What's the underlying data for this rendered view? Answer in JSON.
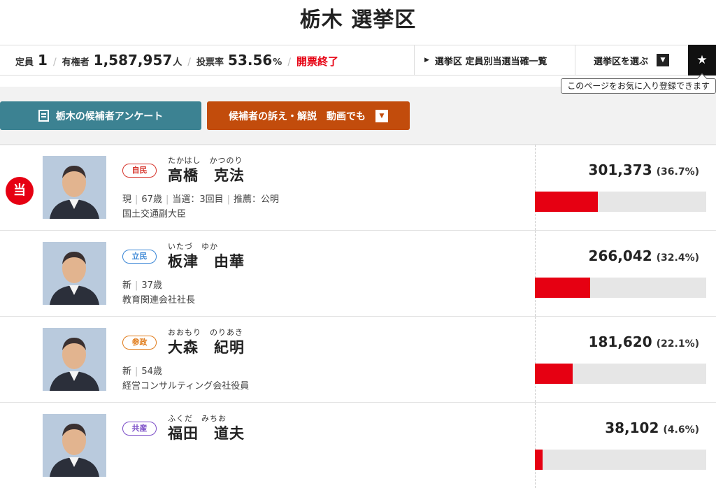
{
  "page": {
    "title": "栃木 選挙区"
  },
  "info": {
    "seats_label": "定員",
    "seats": "1",
    "voters_label": "有権者",
    "voters": "1,587,957",
    "voters_unit": "人",
    "turnout_label": "投票率",
    "turnout": "53.56",
    "turnout_unit": "%",
    "status": "開票終了"
  },
  "nav": {
    "list_link": "選挙区 定員別当選当確一覧",
    "select_label": "選挙区を選ぶ",
    "tooltip": "このページをお気に入り登録できます"
  },
  "buttons": {
    "survey": "栃木の候補者アンケート",
    "video": "候補者の訴え・解説　動画でも"
  },
  "candidates": [
    {
      "elected": true,
      "elected_label": "当",
      "party": "自民",
      "party_color": "#d6332a",
      "kana": "たかはし　かつのり",
      "name": "高橋　克法",
      "meta": [
        "現",
        "67歳",
        "当選：3回目",
        "推薦：公明"
      ],
      "job": "国土交通副大臣",
      "votes": "301,373",
      "pct": "(36.7%)",
      "share": 36.7
    },
    {
      "elected": false,
      "party": "立民",
      "party_color": "#3a86d6",
      "kana": "いたづ　ゆか",
      "name": "板津　由華",
      "meta": [
        "新",
        "37歳"
      ],
      "job": "教育関連会社社長",
      "votes": "266,042",
      "pct": "(32.4%)",
      "share": 32.4
    },
    {
      "elected": false,
      "party": "参政",
      "party_color": "#e07b1a",
      "kana": "おおもり　のりあき",
      "name": "大森　紀明",
      "meta": [
        "新",
        "54歳"
      ],
      "job": "経営コンサルティング会社役員",
      "votes": "181,620",
      "pct": "(22.1%)",
      "share": 22.1
    },
    {
      "elected": false,
      "party": "共産",
      "party_color": "#7a4cc7",
      "kana": "ふくだ　みちお",
      "name": "福田　道夫",
      "meta": [],
      "job": "",
      "votes": "38,102",
      "pct": "(4.6%)",
      "share": 4.6
    }
  ]
}
